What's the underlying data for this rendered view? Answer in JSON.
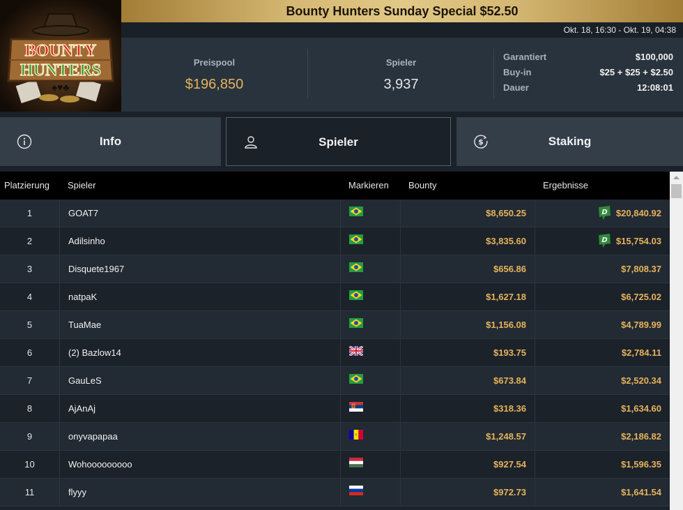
{
  "logo": {
    "line1": "BOUNTY",
    "line2": "HUNTERS"
  },
  "title": "Bounty Hunters Sunday Special $52.50",
  "dates": "Okt. 18, 16:30 - Okt. 19, 04:38",
  "stats": {
    "prizepool_label": "Preispool",
    "prizepool_value": "$196,850",
    "players_label": "Spieler",
    "players_value": "3,937"
  },
  "details": [
    {
      "label": "Garantiert",
      "value": "$100,000"
    },
    {
      "label": "Buy-in",
      "value": "$25 + $25 + $2.50"
    },
    {
      "label": "Dauer",
      "value": "12:08:01"
    }
  ],
  "tabs": [
    {
      "label": "Info",
      "icon": "info-icon"
    },
    {
      "label": "Spieler",
      "icon": "user-icon"
    },
    {
      "label": "Staking",
      "icon": "dollar-icon"
    }
  ],
  "table": {
    "columns": [
      "Platzierung",
      "Spieler",
      "Markieren",
      "Bounty",
      "Ergebnisse"
    ],
    "rows": [
      {
        "rank": "1",
        "player": "GOAT7",
        "flag": "brazil",
        "bounty": "$8,650.25",
        "result": "$20,840.92",
        "badge": true
      },
      {
        "rank": "2",
        "player": "Adilsinho",
        "flag": "brazil",
        "bounty": "$3,835.60",
        "result": "$15,754.03",
        "badge": true
      },
      {
        "rank": "3",
        "player": "Disquete1967",
        "flag": "brazil",
        "bounty": "$656.86",
        "result": "$7,808.37",
        "badge": false
      },
      {
        "rank": "4",
        "player": "natpaK",
        "flag": "brazil",
        "bounty": "$1,627.18",
        "result": "$6,725.02",
        "badge": false
      },
      {
        "rank": "5",
        "player": "TuaMae",
        "flag": "brazil",
        "bounty": "$1,156.08",
        "result": "$4,789.99",
        "badge": false
      },
      {
        "rank": "6",
        "player": "(2) Bazlow14",
        "flag": "uk",
        "bounty": "$193.75",
        "result": "$2,784.11",
        "badge": false
      },
      {
        "rank": "7",
        "player": "GauLeS",
        "flag": "brazil",
        "bounty": "$673.84",
        "result": "$2,520.34",
        "badge": false
      },
      {
        "rank": "8",
        "player": "AjAnAj",
        "flag": "serbia",
        "bounty": "$318.36",
        "result": "$1,634.60",
        "badge": false
      },
      {
        "rank": "9",
        "player": "onyvapapaa",
        "flag": "andorra",
        "bounty": "$1,248.57",
        "result": "$2,186.82",
        "badge": false
      },
      {
        "rank": "10",
        "player": "Wohooooooooo",
        "flag": "hungary",
        "bounty": "$927.54",
        "result": "$1,596.35",
        "badge": false
      },
      {
        "rank": "11",
        "player": "flyyy",
        "flag": "russia",
        "bounty": "$972.73",
        "result": "$1,641.54",
        "badge": false
      }
    ]
  },
  "colors": {
    "gold": "#e6b35c",
    "badge_green": "#2f8a3b"
  }
}
